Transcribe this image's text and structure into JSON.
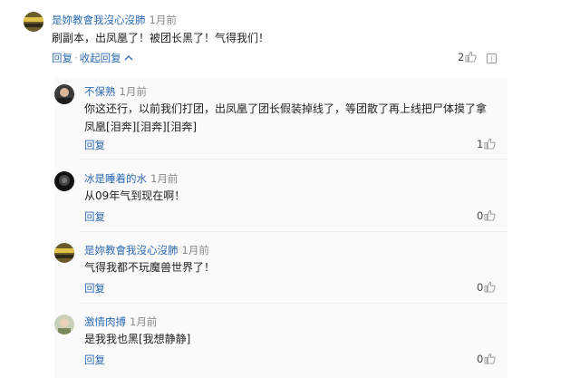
{
  "comments": [
    {
      "author": "是妳教會我沒心沒肺",
      "time": "1月前",
      "text": "刷副本，出凤凰了！被团长黑了！气得我们！",
      "actions": {
        "reply": "回复",
        "collapse": "收起回复"
      },
      "likes": "2"
    },
    {
      "author": "不保熟",
      "time": "1月前",
      "text": "你这还行，以前我们打团，出凤凰了团长假装掉线了，等团散了再上线把尸体摸了拿凤凰[泪奔][泪奔][泪奔]",
      "actions": {
        "reply": "回复"
      },
      "likes": "1"
    },
    {
      "author": "冰是睡着的水",
      "time": "1月前",
      "text": "从09年气到现在啊！",
      "actions": {
        "reply": "回复"
      },
      "likes": "0"
    },
    {
      "author": "是妳教會我沒心沒肺",
      "time": "1月前",
      "text": "气得我都不玩魔兽世界了！",
      "actions": {
        "reply": "回复"
      },
      "likes": "0"
    },
    {
      "author": "激情肉搏",
      "time": "1月前",
      "text": "是我我也黑[我想静静]",
      "actions": {
        "reply": "回复"
      },
      "likes": "0"
    }
  ],
  "colors": {
    "link": "#2d6ab3",
    "meta": "#888888"
  }
}
